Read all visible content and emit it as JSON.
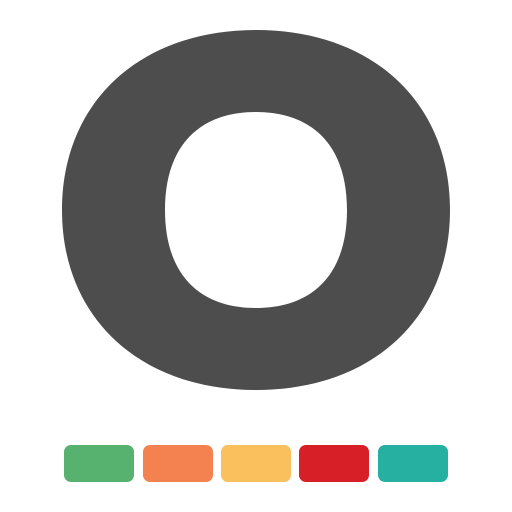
{
  "logo": {
    "icon": "letter-o-logo",
    "color": "#4d4d4d"
  },
  "palette": {
    "swatches": [
      {
        "name": "green",
        "color": "#58b26f"
      },
      {
        "name": "orange",
        "color": "#f48250"
      },
      {
        "name": "yellow",
        "color": "#fac05e"
      },
      {
        "name": "red",
        "color": "#d71f27"
      },
      {
        "name": "teal",
        "color": "#25b0a1"
      }
    ]
  }
}
